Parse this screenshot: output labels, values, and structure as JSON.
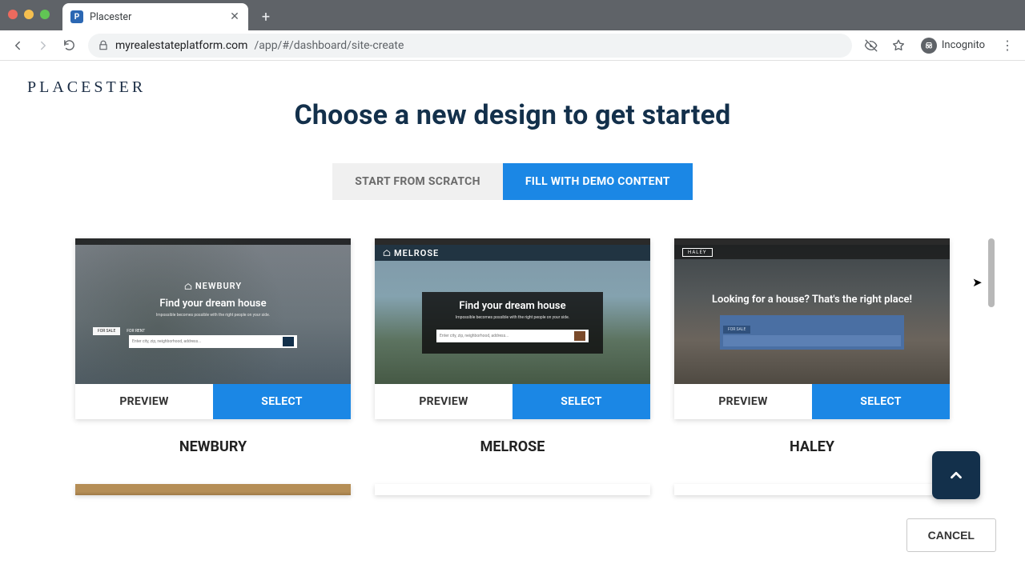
{
  "browser": {
    "tab_title": "Placester",
    "url_host": "myrealestateplatform.com",
    "url_path": "/app/#/dashboard/site-create",
    "incognito_label": "Incognito"
  },
  "page": {
    "logo": "PLACESTER",
    "heading": "Choose a new design to get started",
    "toggle": {
      "scratch": "START FROM SCRATCH",
      "demo": "FILL WITH DEMO CONTENT"
    },
    "templates": [
      {
        "name": "NEWBURY",
        "preview_label": "PREVIEW",
        "select_label": "SELECT",
        "thumb": {
          "logo": "NEWBURY",
          "headline": "Find your dream house",
          "sub": "Impossible becomes possible with the right people on your side.",
          "tab_for_sale": "FOR SALE",
          "tab_for_rent": "FOR RENT",
          "search_placeholder": "Enter city, zip, neighborhood, address..."
        }
      },
      {
        "name": "MELROSE",
        "preview_label": "PREVIEW",
        "select_label": "SELECT",
        "thumb": {
          "logo": "MELROSE",
          "headline": "Find your dream house",
          "sub": "Impossible becomes possible with the right people on your side.",
          "search_placeholder": "Enter city, zip, neighborhood, address..."
        }
      },
      {
        "name": "HALEY",
        "preview_label": "PREVIEW",
        "select_label": "SELECT",
        "thumb": {
          "logo": "HALEY",
          "headline": "Looking for a house? That's the right place!",
          "tab_for_sale": "FOR SALE"
        }
      }
    ],
    "cancel": "CANCEL"
  }
}
